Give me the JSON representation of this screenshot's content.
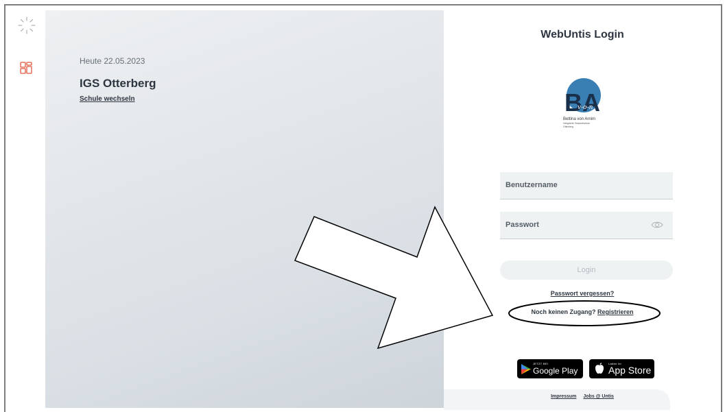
{
  "left": {
    "date": "Heute 22.05.2023",
    "school": "IGS Otterberg",
    "switch_link": "Schule wechseln"
  },
  "login": {
    "title": "WebUntis Login",
    "username_placeholder": "Benutzername",
    "password_placeholder": "Passwort",
    "login_button": "Login",
    "forgot_link": "Passwort vergessen?",
    "no_access_text": "Noch keinen Zugang? ",
    "register_link": "Registrieren"
  },
  "logo": {
    "letters": "BA",
    "script": "v-o-n",
    "line1": "Bettina von Arnim",
    "line2": "Integrierte Gesamtschule",
    "line3": "Otterberg"
  },
  "stores": {
    "google_small": "JETZT BEI",
    "google_big": "Google Play",
    "apple_small": "Laden im",
    "apple_big": "App Store"
  },
  "footer": {
    "impressum": "Impressum",
    "jobs": "Jobs @ Untis"
  },
  "colors": {
    "accent": "#e2583e",
    "text_dark": "#2d3640",
    "field_bg": "#eef2f2"
  }
}
